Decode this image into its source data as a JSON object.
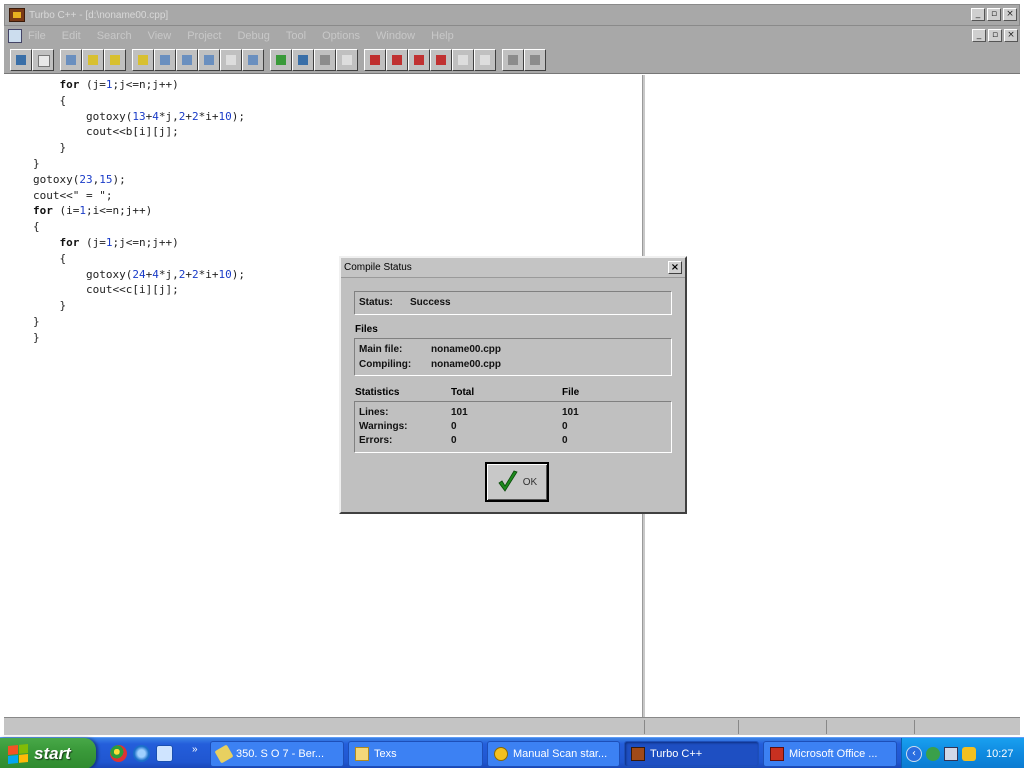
{
  "window": {
    "title": "Turbo C++ - [d:\\noname00.cpp]",
    "minimize_glyph": "_",
    "restore_glyph": "▫",
    "close_glyph": "×"
  },
  "menu": {
    "items": [
      "File",
      "Edit",
      "Search",
      "View",
      "Project",
      "Debug",
      "Tool",
      "Options",
      "Window",
      "Help"
    ]
  },
  "toolbar": {
    "groups": [
      [
        "open-icon",
        "save-icon"
      ],
      [
        "cut-icon",
        "copy-icon",
        "paste-icon"
      ],
      [
        "search-icon",
        "find-icon",
        "replace-icon",
        "search-again-icon",
        "goto-icon",
        "tile-icon"
      ],
      [
        "undo-icon",
        "cut-tool-icon",
        "copy-tool-icon",
        "help-icon"
      ],
      [
        "compile-icon",
        "make-icon",
        "build-icon",
        "run-icon",
        "debug-icon",
        "step-icon"
      ],
      [
        "cascade-icon",
        "tile-windows-icon"
      ]
    ]
  },
  "code": {
    "lines": [
      "    for (j=1;j<=n;j++)",
      "    {",
      "        gotoxy(13+4*j,2+2*i+10);",
      "        cout<<b[i][j];",
      "    }",
      "}",
      "gotoxy(23,15);",
      "cout<<\" = \";",
      "for (i=1;i<=n;j++)",
      "{",
      "    for (j=1;j<=n;j++)",
      "    {",
      "        gotoxy(24+4*j,2+2*i+10);",
      "        cout<<c[i][j];",
      "    }",
      "}",
      "}"
    ]
  },
  "dialog": {
    "title": "Compile Status",
    "close_glyph": "×",
    "status_label": "Status:",
    "status_value": "Success",
    "files_heading": "Files",
    "main_file_label": "Main file:",
    "main_file_value": "noname00.cpp",
    "compiling_label": "Compiling:",
    "compiling_value": "noname00.cpp",
    "statistics_heading": "Statistics",
    "total_heading": "Total",
    "file_heading": "File",
    "lines_label": "Lines:",
    "lines_total": "101",
    "lines_file": "101",
    "warnings_label": "Warnings:",
    "warnings_total": "0",
    "warnings_file": "0",
    "errors_label": "Errors:",
    "errors_total": "0",
    "errors_file": "0",
    "ok_label": "OK"
  },
  "taskbar": {
    "start_label": "start",
    "more_glyph": "»",
    "tasks": [
      {
        "label": "350. S O 7 - Ber...",
        "icon": "tool-icon"
      },
      {
        "label": "Texs",
        "icon": "folder-icon"
      },
      {
        "label": "Manual Scan star...",
        "icon": "antivirus-icon"
      },
      {
        "label": "Turbo C++",
        "icon": "turbo-cpp-icon"
      },
      {
        "label": "Microsoft Office ...",
        "icon": "office-icon"
      }
    ],
    "tray_chevron": "‹",
    "clock": "10:27"
  }
}
